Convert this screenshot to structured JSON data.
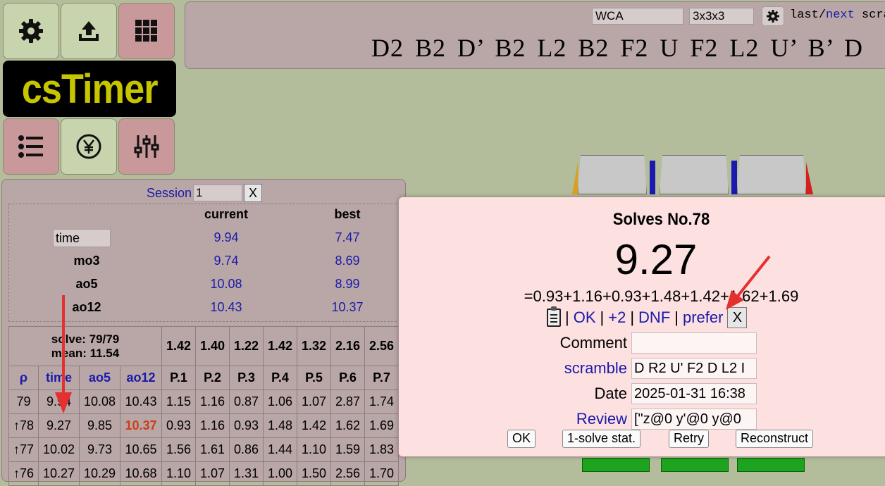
{
  "toolbar": {
    "options_icon": "gear-icon",
    "export_icon": "upload-icon",
    "scramble_icon": "grid-icon",
    "stats_icon": "list-icon",
    "donate_icon": "yen-icon",
    "tools_icon": "sliders-icon",
    "logo_text": "csTimer"
  },
  "scramble_bar": {
    "type": "WCA",
    "puzzle": "3x3x3",
    "last": "last",
    "sep": "/",
    "next": "next",
    "scramble_word": "scram",
    "scramble": "D2 B2 D’ B2 L2 B2 F2 U F2 L2 U’ B’ D"
  },
  "stats": {
    "session_label": "Session",
    "session_value": "1",
    "close": "X",
    "headers": {
      "current": "current",
      "best": "best"
    },
    "rows": [
      {
        "label": "time",
        "current": "9.94",
        "best": "7.47"
      },
      {
        "label": "mo3",
        "current": "9.74",
        "best": "8.69"
      },
      {
        "label": "ao5",
        "current": "10.08",
        "best": "8.99"
      },
      {
        "label": "ao12",
        "current": "10.43",
        "best": "10.37"
      }
    ],
    "solve_count": "solve: 79/79",
    "mean": "mean: 11.54",
    "phase_avgs": [
      "1.42",
      "1.40",
      "1.22",
      "1.42",
      "1.32",
      "2.16",
      "2.56"
    ],
    "col_headers": [
      "ρ",
      "time",
      "ao5",
      "ao12",
      "P.1",
      "P.2",
      "P.3",
      "P.4",
      "P.5",
      "P.6",
      "P.7"
    ],
    "list": [
      [
        "79",
        "9.94",
        "10.08",
        "10.43",
        "1.15",
        "1.16",
        "0.87",
        "1.06",
        "1.07",
        "2.87",
        "1.74"
      ],
      [
        "↑78",
        "9.27",
        "9.85",
        "10.37",
        "0.93",
        "1.16",
        "0.93",
        "1.48",
        "1.42",
        "1.62",
        "1.69"
      ],
      [
        "↑77",
        "10.02",
        "9.73",
        "10.65",
        "1.56",
        "1.61",
        "0.86",
        "1.44",
        "1.10",
        "1.59",
        "1.83"
      ],
      [
        "↑76",
        "10.27",
        "10.29",
        "10.68",
        "1.10",
        "1.07",
        "1.31",
        "1.00",
        "1.50",
        "2.56",
        "1.70"
      ]
    ]
  },
  "dialog": {
    "title": "Solves No.78",
    "time": "9.27",
    "splits": "=0.93+1.16+0.93+1.48+1.42+1.62+1.69",
    "actions": {
      "sep": "|",
      "ok": "OK",
      "plus2": "+2",
      "dnf": "DNF",
      "prefer": "prefer",
      "close": "X"
    },
    "comment_label": "Comment",
    "comment_value": "",
    "scramble_label": "scramble",
    "scramble_value": "D R2 U' F2 D L2 I",
    "date_label": "Date",
    "date_value": "2025-01-31 16:38",
    "review_label": "Review",
    "review_value": "[\"z@0 y'@0 y@0",
    "buttons": {
      "ok": "OK",
      "stat": "1-solve stat.",
      "retry": "Retry",
      "reconstruct": "Reconstruct"
    }
  },
  "colors": {
    "background": "#b4bd9b",
    "panel": "#b9a6a6",
    "dialog": "#fde0e0",
    "link": "#1a1aaa",
    "highlight": "#c8401a",
    "logo_text": "#c7c400",
    "annotation_arrow": "#e53030"
  }
}
